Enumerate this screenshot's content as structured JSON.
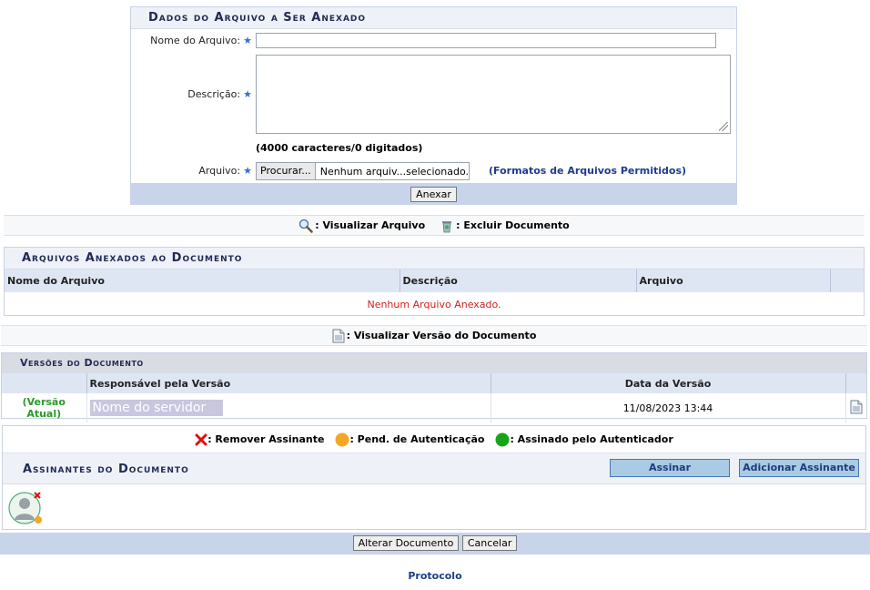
{
  "upload": {
    "title": "Dados do Arquivo a Ser Anexado",
    "nome_label": "Nome do Arquivo:",
    "nome_value": "",
    "descricao_label": "Descrição:",
    "descricao_value": "",
    "char_count": "(4000 caracteres/0 digitados)",
    "arquivo_label": "Arquivo:",
    "browse_label": "Procurar...",
    "file_status": "Nenhum arquiv...selecionado.",
    "formatos_link": "(Formatos de Arquivos Permitidos)",
    "anexar_label": "Anexar",
    "required_mark": "★"
  },
  "legend1": {
    "visualizar": ": Visualizar Arquivo",
    "excluir": ": Excluir Documento"
  },
  "anexos": {
    "title": "Arquivos Anexados ao Documento",
    "columns": [
      "Nome do Arquivo",
      "Descrição",
      "Arquivo"
    ],
    "empty_message": "Nenhum Arquivo Anexado."
  },
  "legend2": {
    "visualizar_versao": ": Visualizar Versão do Documento"
  },
  "versoes": {
    "title": "Versões do Documento",
    "columns": [
      "Responsável pela Versão",
      "Data da Versão"
    ],
    "rows": [
      {
        "status": "(Versão Atual)",
        "responsavel": "Nome do servidor",
        "data": "11/08/2023 13:44"
      }
    ]
  },
  "assinantes": {
    "legend_remover": ": Remover Assinante",
    "legend_pend": ": Pend. de Autenticação",
    "legend_assinado": ": Assinado pelo Autenticador",
    "title": "Assinantes do Documento",
    "assinar_label": "Assinar",
    "adicionar_label": "Adicionar Assinante"
  },
  "actions": {
    "alterar_label": "Alterar Documento",
    "cancelar_label": "Cancelar"
  },
  "footer": {
    "link": "Protocolo"
  },
  "colors": {
    "accent_blue": "#1e3c8c",
    "panel_header": "#eef2f8",
    "footer_bar": "#c8d4ea",
    "error_red": "#cc2222",
    "current_green": "#2b9a2b",
    "pending_orange": "#f5a623",
    "signed_green": "#16a516",
    "remove_red": "#e01010"
  }
}
